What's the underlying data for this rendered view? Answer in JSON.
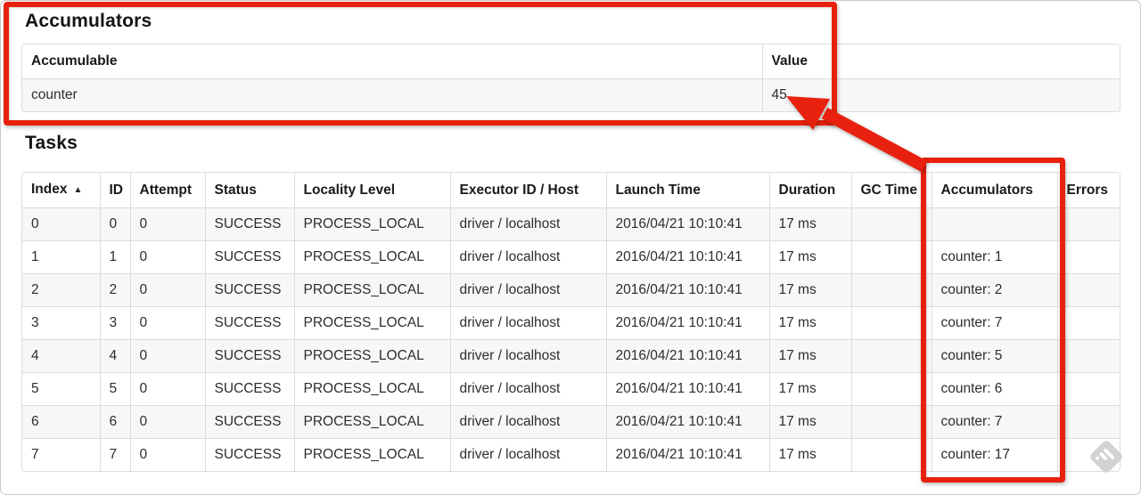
{
  "annotation": {
    "color": "#e7210e"
  },
  "accumulators_section": {
    "heading": "Accumulators",
    "table": {
      "headers": [
        "Accumulable",
        "Value"
      ],
      "rows": [
        [
          "counter",
          "45"
        ]
      ]
    }
  },
  "tasks_section": {
    "heading": "Tasks",
    "table": {
      "sort_icon": "▲",
      "sorted_column": "Index",
      "headers": [
        "Index",
        "ID",
        "Attempt",
        "Status",
        "Locality Level",
        "Executor ID / Host",
        "Launch Time",
        "Duration",
        "GC Time",
        "Accumulators",
        "Errors"
      ],
      "rows": [
        [
          "0",
          "0",
          "0",
          "SUCCESS",
          "PROCESS_LOCAL",
          "driver / localhost",
          "2016/04/21 10:10:41",
          "17 ms",
          "",
          "",
          ""
        ],
        [
          "1",
          "1",
          "0",
          "SUCCESS",
          "PROCESS_LOCAL",
          "driver / localhost",
          "2016/04/21 10:10:41",
          "17 ms",
          "",
          "counter: 1",
          ""
        ],
        [
          "2",
          "2",
          "0",
          "SUCCESS",
          "PROCESS_LOCAL",
          "driver / localhost",
          "2016/04/21 10:10:41",
          "17 ms",
          "",
          "counter: 2",
          ""
        ],
        [
          "3",
          "3",
          "0",
          "SUCCESS",
          "PROCESS_LOCAL",
          "driver / localhost",
          "2016/04/21 10:10:41",
          "17 ms",
          "",
          "counter: 7",
          ""
        ],
        [
          "4",
          "4",
          "0",
          "SUCCESS",
          "PROCESS_LOCAL",
          "driver / localhost",
          "2016/04/21 10:10:41",
          "17 ms",
          "",
          "counter: 5",
          ""
        ],
        [
          "5",
          "5",
          "0",
          "SUCCESS",
          "PROCESS_LOCAL",
          "driver / localhost",
          "2016/04/21 10:10:41",
          "17 ms",
          "",
          "counter: 6",
          ""
        ],
        [
          "6",
          "6",
          "0",
          "SUCCESS",
          "PROCESS_LOCAL",
          "driver / localhost",
          "2016/04/21 10:10:41",
          "17 ms",
          "",
          "counter: 7",
          ""
        ],
        [
          "7",
          "7",
          "0",
          "SUCCESS",
          "PROCESS_LOCAL",
          "driver / localhost",
          "2016/04/21 10:10:41",
          "17 ms",
          "",
          "counter: 17",
          ""
        ]
      ]
    }
  }
}
